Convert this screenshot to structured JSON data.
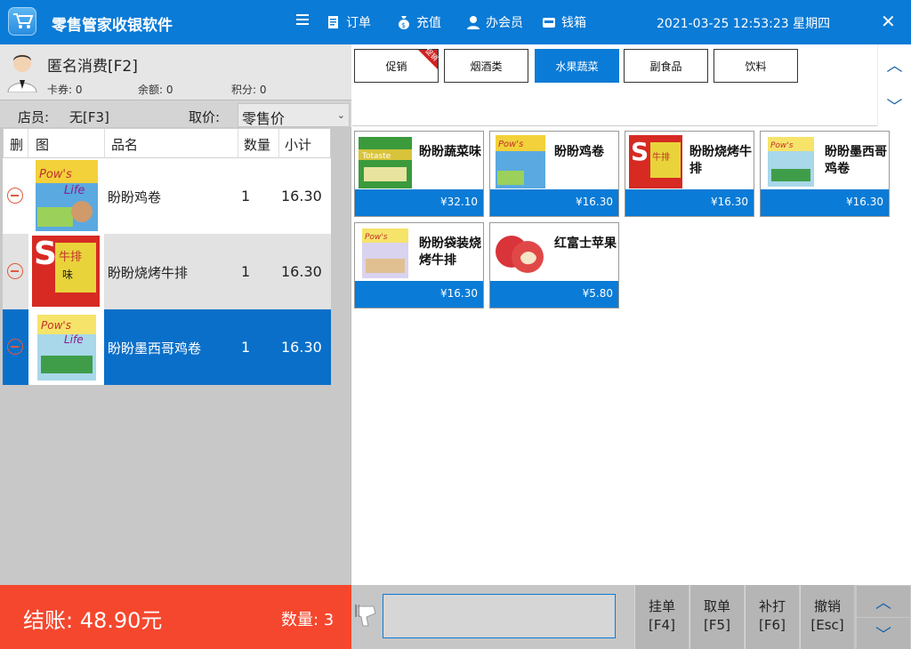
{
  "app": {
    "title": "零售管家收银软件",
    "datetime": "2021-03-25 12:53:23",
    "weekday": "星期四"
  },
  "toolbar": {
    "orders": "订单",
    "recharge": "充值",
    "member": "办会员",
    "cashbox": "钱箱"
  },
  "member": {
    "name": "匿名消费[F2]",
    "cards_label": "卡券: 0",
    "balance_label": "余额: 0",
    "points_label": "积分: 0"
  },
  "staff": {
    "label": "店员:",
    "value": "无[F3]",
    "price_label": "取价:",
    "price_value": "零售价"
  },
  "table": {
    "headers": [
      "删",
      "图",
      "品名",
      "数量",
      "小计"
    ],
    "rows": [
      {
        "name": "盼盼鸡卷",
        "qty": "1",
        "subtotal": "16.30"
      },
      {
        "name": "盼盼烧烤牛排",
        "qty": "1",
        "subtotal": "16.30"
      },
      {
        "name": "盼盼墨西哥鸡卷",
        "qty": "1",
        "subtotal": "16.30"
      }
    ]
  },
  "categories": [
    {
      "label": "促销",
      "ribbon": "促销"
    },
    {
      "label": "烟酒类"
    },
    {
      "label": "水果蔬菜",
      "active": true
    },
    {
      "label": "副食品"
    },
    {
      "label": "饮料"
    }
  ],
  "products": [
    {
      "name": "盼盼蔬菜味",
      "price": "¥32.10"
    },
    {
      "name": "盼盼鸡卷",
      "price": "¥16.30"
    },
    {
      "name": "盼盼烧烤牛排",
      "price": "¥16.30"
    },
    {
      "name": "盼盼墨西哥鸡卷",
      "price": "¥16.30"
    },
    {
      "name": "盼盼袋装烧烤牛排",
      "price": "¥16.30"
    },
    {
      "name": "红富士苹果",
      "price": "¥5.80"
    }
  ],
  "checkout": {
    "total_label": "结账: 48.90元",
    "count_label": "数量: 3"
  },
  "fkeys": [
    {
      "label": "挂单",
      "key": "[F4]"
    },
    {
      "label": "取单",
      "key": "[F5]"
    },
    {
      "label": "补打",
      "key": "[F6]"
    },
    {
      "label": "撤销",
      "key": "[Esc]"
    }
  ],
  "colors": {
    "accent": "#0a7bd6",
    "checkout": "#f5472d",
    "selected_row": "#0a6fc9"
  }
}
